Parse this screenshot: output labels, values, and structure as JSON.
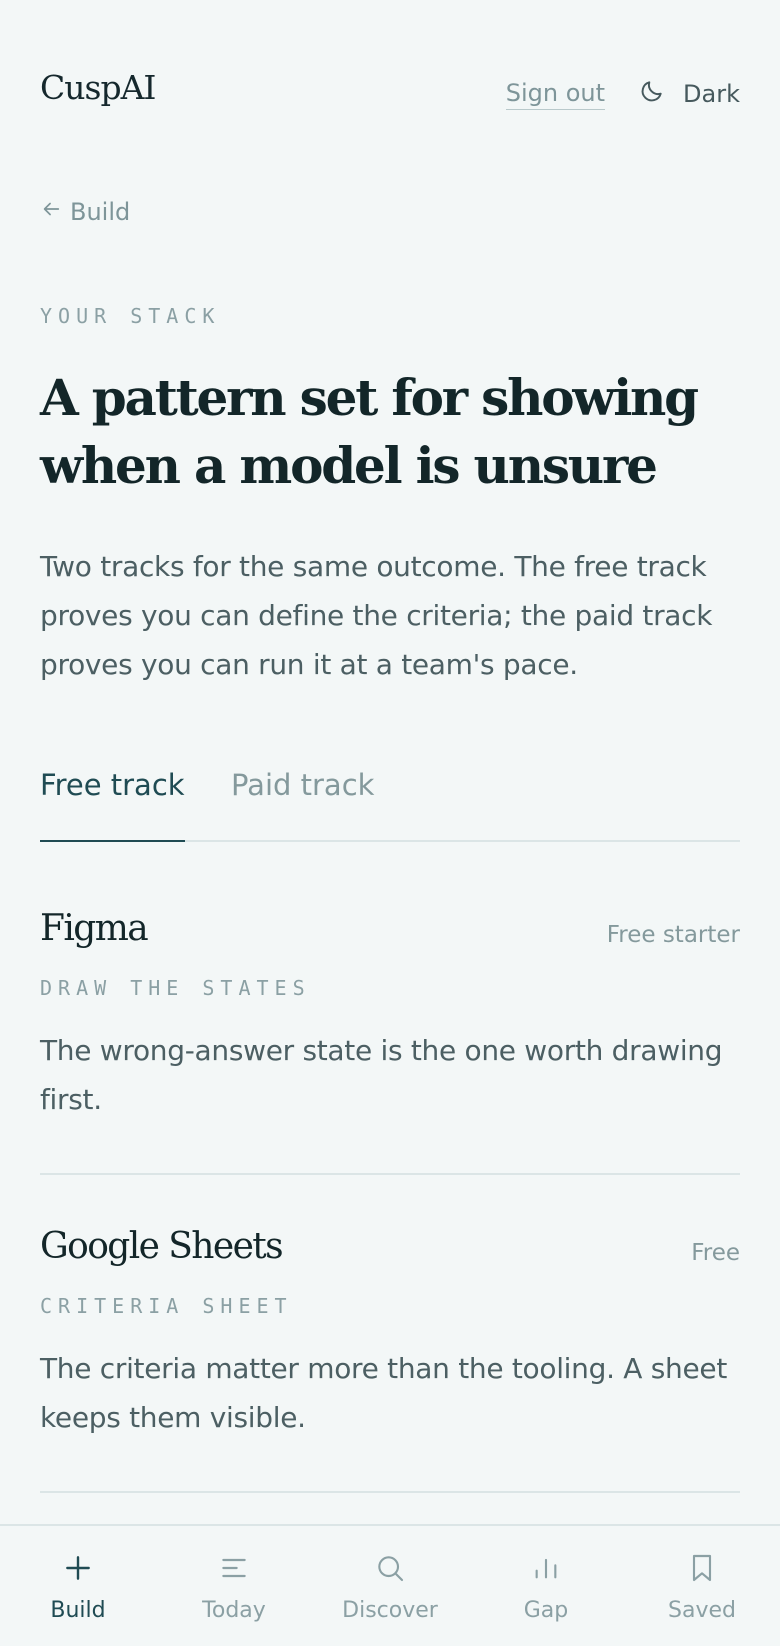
{
  "header": {
    "logo": "CuspAI",
    "sign_out": "Sign out",
    "theme_label": "Dark"
  },
  "back": {
    "label": "Build"
  },
  "eyebrow": "YOUR STACK",
  "title": "A pattern set for showing when a model is unsure",
  "intro": "Two tracks for the same outcome. The free track proves you can define the criteria; the paid track proves you can run it at a team's pace.",
  "tabs": [
    {
      "label": "Free track",
      "active": true
    },
    {
      "label": "Paid track",
      "active": false
    }
  ],
  "tools": [
    {
      "name": "Figma",
      "price": "Free starter",
      "category": "DRAW THE STATES",
      "description": "The wrong-answer state is the one worth drawing first."
    },
    {
      "name": "Google Sheets",
      "price": "Free",
      "category": "CRITERIA SHEET",
      "description": "The criteria matter more than the tooling. A sheet keeps them visible."
    }
  ],
  "nav": [
    {
      "label": "Build",
      "icon": "plus-icon",
      "active": true
    },
    {
      "label": "Today",
      "icon": "list-icon",
      "active": false
    },
    {
      "label": "Discover",
      "icon": "search-icon",
      "active": false
    },
    {
      "label": "Gap",
      "icon": "bar-chart-icon",
      "active": false
    },
    {
      "label": "Saved",
      "icon": "bookmark-icon",
      "active": false
    }
  ],
  "colors": {
    "background": "#f3f7f7",
    "accent": "#1f4b53",
    "muted": "#84999c",
    "text": "#132629"
  }
}
